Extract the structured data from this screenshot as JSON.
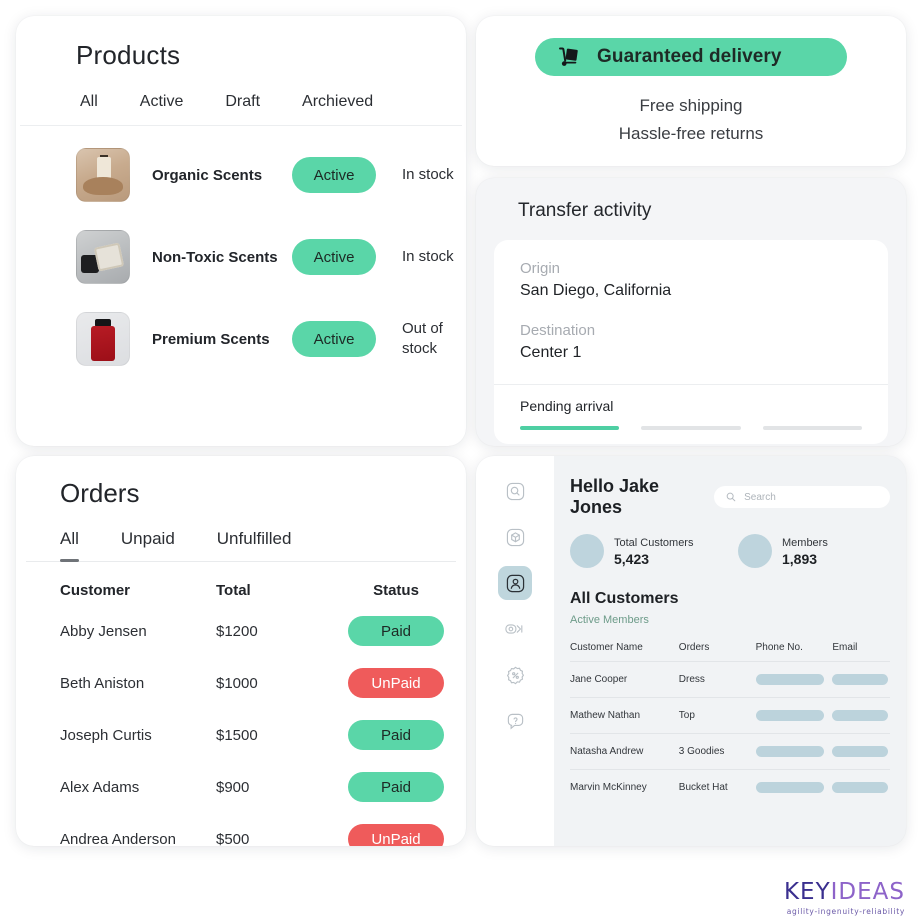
{
  "products": {
    "title": "Products",
    "tabs": [
      {
        "label": "All"
      },
      {
        "label": "Active"
      },
      {
        "label": "Draft"
      },
      {
        "label": "Archieved"
      }
    ],
    "rows": [
      {
        "name": "Organic Scents",
        "status": "Active",
        "stock": "In stock",
        "thumb": "perfume-bottle-beige-thumbnail"
      },
      {
        "name": "Non-Toxic Scents",
        "status": "Active",
        "stock": "In stock",
        "thumb": "perfume-bottle-gray-thumbnail"
      },
      {
        "name": "Premium Scents",
        "status": "Active",
        "stock": "Out of stock",
        "thumb": "perfume-bottle-red-thumbnail"
      }
    ]
  },
  "delivery": {
    "banner_label": "Guaranteed delivery",
    "banner_icon": "hand-truck-icon",
    "lines": [
      {
        "text": "Free shipping"
      },
      {
        "text": "Hassle-free returns"
      }
    ]
  },
  "transfer": {
    "title": "Transfer activity",
    "origin_label": "Origin",
    "origin_value": "San Diego, California",
    "destination_label": "Destination",
    "destination_value": "Center 1",
    "status": "Pending arrival",
    "progress_steps": 3,
    "progress_completed": 1
  },
  "orders": {
    "title": "Orders",
    "tabs": [
      {
        "label": "All",
        "active": true
      },
      {
        "label": "Unpaid",
        "active": false
      },
      {
        "label": "Unfulfilled",
        "active": false
      }
    ],
    "columns": [
      {
        "label": "Customer"
      },
      {
        "label": "Total"
      },
      {
        "label": "Status"
      }
    ],
    "rows": [
      {
        "customer": "Abby Jensen",
        "total": "$1200",
        "status": "Paid"
      },
      {
        "customer": "Beth Aniston",
        "total": "$1000",
        "status": "UnPaid"
      },
      {
        "customer": "Joseph Curtis",
        "total": "$1500",
        "status": "Paid"
      },
      {
        "customer": "Alex Adams",
        "total": "$900",
        "status": "Paid"
      },
      {
        "customer": "Andrea Anderson",
        "total": "$500",
        "status": "UnPaid"
      }
    ]
  },
  "customers": {
    "sidebar": [
      {
        "icon": "search-icon",
        "active": false
      },
      {
        "icon": "package-box-icon",
        "active": false
      },
      {
        "icon": "user-profile-icon",
        "active": true
      },
      {
        "icon": "payment-card-icon",
        "active": false
      },
      {
        "icon": "discount-badge-icon",
        "active": false
      },
      {
        "icon": "help-question-icon",
        "active": false
      }
    ],
    "greeting": "Hello Jake Jones",
    "search_placeholder": "Search",
    "stats": [
      {
        "label": "Total Customers",
        "value": "5,423"
      },
      {
        "label": "Members",
        "value": "1,893"
      }
    ],
    "section_title": "All Customers",
    "section_subtitle": "Active Members",
    "columns": [
      {
        "label": "Customer Name"
      },
      {
        "label": "Orders"
      },
      {
        "label": "Phone No."
      },
      {
        "label": "Email"
      }
    ],
    "rows": [
      {
        "name": "Jane Cooper",
        "order": "Dress",
        "phone": "",
        "email": ""
      },
      {
        "name": "Mathew Nathan",
        "order": "Top",
        "phone": "",
        "email": ""
      },
      {
        "name": "Natasha Andrew",
        "order": "3 Goodies",
        "phone": "",
        "email": ""
      },
      {
        "name": "Marvin McKinney",
        "order": "Bucket Hat",
        "phone": "",
        "email": ""
      }
    ]
  },
  "logo": {
    "part1": "KEY",
    "part2": "IDEAS",
    "tagline": "agility-ingenuity-reliability"
  },
  "colors": {
    "accent_green": "#5ad6a8",
    "accent_red": "#ef5b5b",
    "progress_green": "#4ecfa3",
    "stat_circle": "#bed4dd",
    "redact_bar": "#bcd3dc",
    "panel_bg": "#f1f3f5",
    "logo_key": "#3a2f8f",
    "logo_ideas": "#8d63c9"
  }
}
